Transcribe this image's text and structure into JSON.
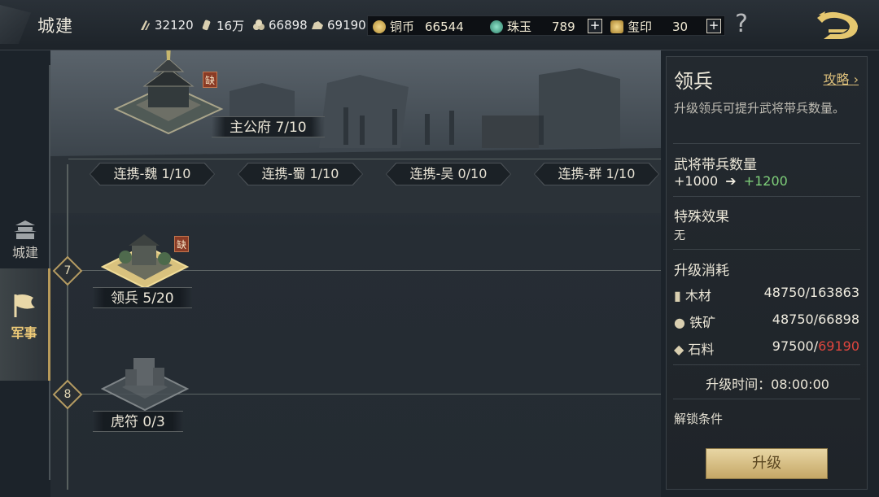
{
  "header": {
    "title": "城建",
    "resources": [
      {
        "icon": "wood-icon",
        "value": "32120"
      },
      {
        "icon": "scroll-icon",
        "value": "16万"
      },
      {
        "icon": "iron-ore-icon",
        "value": "66898"
      },
      {
        "icon": "stone-icon",
        "value": "69190"
      }
    ],
    "currencies": [
      {
        "icon": "copper-coin-icon",
        "label": "铜币",
        "value": "66544",
        "addable": false
      },
      {
        "icon": "jade-icon",
        "label": "珠玉",
        "value": "789",
        "addable": true
      },
      {
        "icon": "seal-icon",
        "label": "玺印",
        "value": "30",
        "addable": true
      }
    ],
    "plus": "+",
    "help": "?"
  },
  "sidebar": {
    "tabs": [
      {
        "label": "城建",
        "active": false
      },
      {
        "label": "军事",
        "active": true
      }
    ]
  },
  "scene": {
    "palace": {
      "label": "主公府 7/10",
      "badge": "缺"
    },
    "alliances": [
      "连携-魏 1/10",
      "连携-蜀 1/10",
      "连携-吴 0/10",
      "连携-群 1/10"
    ],
    "buildings": [
      {
        "level": "7",
        "label": "领兵 5/20",
        "badge": "缺"
      },
      {
        "level": "8",
        "label": "虎符 0/3"
      }
    ]
  },
  "panel": {
    "title": "领兵",
    "guide": "攻略",
    "description": "升级领兵可提升武将带兵数量。",
    "troop_title": "武将带兵数量",
    "troop_from": "+1000",
    "troop_arrow": "➔",
    "troop_to": "+1200",
    "effect_title": "特殊效果",
    "effect_value": "无",
    "cost_title": "升级消耗",
    "costs": [
      {
        "icon": "wood-icon",
        "name": "木材",
        "have": "48750",
        "need": "163863",
        "enough": true
      },
      {
        "icon": "iron-ore-icon",
        "name": "铁矿",
        "have": "48750",
        "need": "66898",
        "enough": true
      },
      {
        "icon": "stone-icon",
        "name": "石料",
        "have": "97500",
        "need": "69190",
        "enough": false
      }
    ],
    "time_label": "升级时间：08:00:00",
    "unlock_title": "解锁条件",
    "upgrade_button": "升级"
  },
  "colors": {
    "accent_gold": "#dcbf7b",
    "green": "#7fd07a",
    "red": "#e0463e"
  }
}
